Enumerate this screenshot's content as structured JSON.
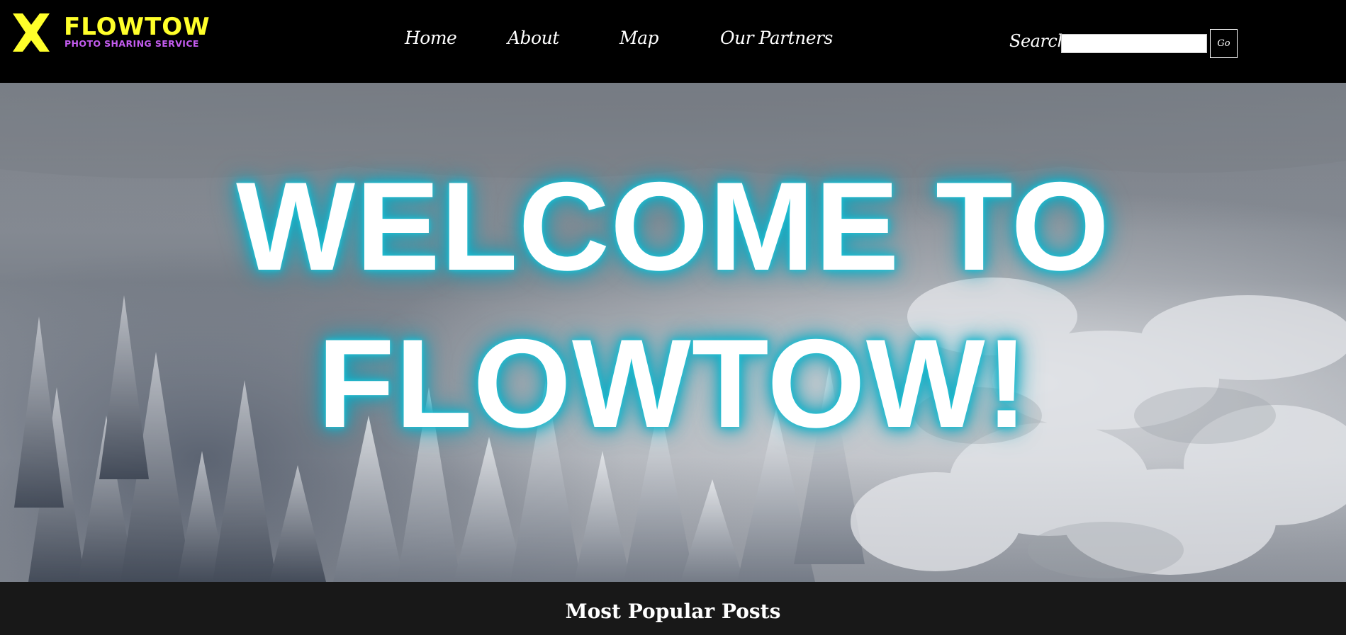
{
  "header": {
    "logo": {
      "name": "FLOWTOW",
      "tagline": "PHOTO SHARING SERVICE",
      "icon": "x-mark-icon",
      "colors": {
        "mark": "#ffff2a",
        "name": "#ffff2a",
        "tagline": "#c45cf0"
      }
    },
    "nav": {
      "items": [
        {
          "label": "Home"
        },
        {
          "label": "About"
        },
        {
          "label": "Map"
        },
        {
          "label": "Our Partners"
        }
      ]
    },
    "search": {
      "label": "Search:",
      "value": "",
      "button_label": "Go"
    }
  },
  "hero": {
    "line1": "WELCOME TO",
    "line2": "FLOWTOW!",
    "glow_color": "#18b6cc",
    "background": "snowy-forest-aerial-photo"
  },
  "popular": {
    "title": "Most Popular Posts"
  }
}
